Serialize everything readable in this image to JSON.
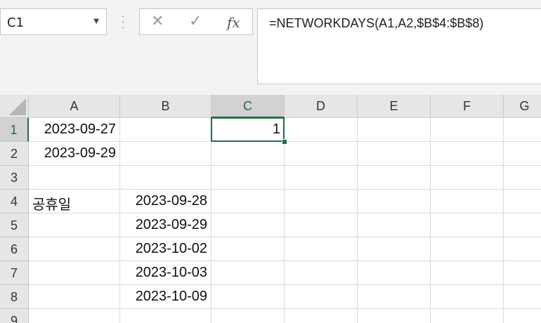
{
  "name_box": {
    "value": "C1"
  },
  "formula_bar": {
    "cancel_glyph": "✕",
    "enter_glyph": "✓",
    "fx_label": "fx",
    "formula": "=NETWORKDAYS(A1,A2,$B$4:$B$8)"
  },
  "columns": [
    "A",
    "B",
    "C",
    "D",
    "E",
    "F",
    "G"
  ],
  "rows": [
    "1",
    "2",
    "3",
    "4",
    "5",
    "6",
    "7",
    "8",
    "9"
  ],
  "active_cell": "C1",
  "cells": {
    "A1": "2023-09-27",
    "A2": "2023-09-29",
    "A4": "공휴일",
    "B4": "2023-09-28",
    "B5": "2023-09-29",
    "B6": "2023-10-02",
    "B7": "2023-10-03",
    "B8": "2023-10-09",
    "C1": "1"
  },
  "colors": {
    "accent": "#217346",
    "header_bg": "#e6e6e6",
    "header_selected": "#d2d2d2"
  }
}
